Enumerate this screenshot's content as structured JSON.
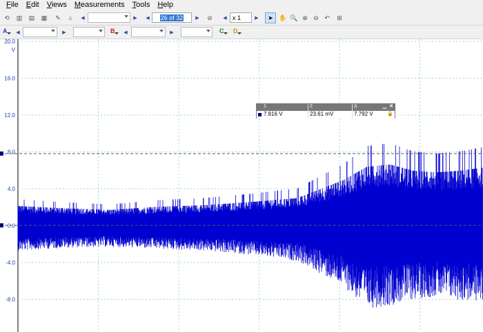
{
  "menu": [
    {
      "label": "File",
      "name": "menu-file"
    },
    {
      "label": "Edit",
      "name": "menu-edit"
    },
    {
      "label": "Views",
      "name": "menu-views"
    },
    {
      "label": "Measurements",
      "name": "menu-measurements"
    },
    {
      "label": "Tools",
      "name": "menu-tools"
    },
    {
      "label": "Help",
      "name": "menu-help"
    }
  ],
  "toolbar": {
    "buffer_page": "26 of 32",
    "zoom": "x 1"
  },
  "channel_bar": {
    "channels": [
      "A",
      "B",
      "C",
      "D"
    ]
  },
  "colors": {
    "trace": "#0000d0",
    "grid": "#9bd3e6",
    "axis_label": "#1a3db0",
    "cursor_dash": "#555555"
  },
  "scope": {
    "y_axis": {
      "unit": "V",
      "ticks": [
        "20.0",
        "16.0",
        "12.0",
        "8.0",
        "4.0",
        "0.0",
        "-4.0",
        "-8.0"
      ],
      "values": [
        20,
        16,
        12,
        8,
        4,
        0,
        -4,
        -8
      ]
    },
    "cursor_levels": [
      7.816,
      0.02361
    ]
  },
  "measurements": {
    "headers": [
      "1",
      "2",
      "Δ"
    ],
    "values": [
      "7.816 V",
      "23.61 mV",
      "7.792 V"
    ]
  },
  "chart_data": {
    "type": "line",
    "ylabel": "V",
    "ylim": [
      -11.0,
      20.0
    ],
    "grid": true,
    "series": [
      {
        "envelope_x_fraction": [
          0.0,
          0.1,
          0.2,
          0.3,
          0.4,
          0.5,
          0.6,
          0.7,
          0.75,
          0.8,
          0.85,
          0.9,
          0.95,
          1.0
        ],
        "envelope_upper": [
          2.5,
          2.2,
          2.0,
          2.4,
          2.6,
          3.0,
          3.5,
          5.8,
          7.5,
          7.8,
          7.0,
          6.8,
          7.0,
          7.4
        ],
        "envelope_lower": [
          -2.5,
          -2.2,
          -2.1,
          -2.3,
          -2.5,
          -2.9,
          -3.5,
          -6.0,
          -8.2,
          -7.9,
          -7.3,
          -7.0,
          -7.4,
          -7.6
        ]
      }
    ]
  }
}
